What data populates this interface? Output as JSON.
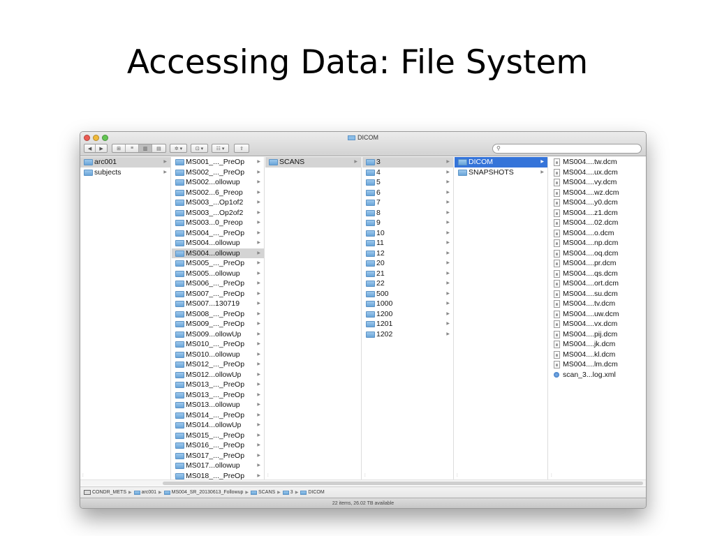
{
  "slide": {
    "title": "Accessing Data: File System"
  },
  "window": {
    "title": "DICOM"
  },
  "toolbar": {
    "back_label": "◀",
    "forward_label": "▶",
    "view_icons": "⊞",
    "view_list": "≡",
    "view_columns": "▥",
    "view_coverflow": "▤",
    "action_label": "✲ ▾",
    "arrange_label": "☷ ▾",
    "share_label": "⇪",
    "dropbox_label": "⊡ ▾",
    "search_icon": "⚲"
  },
  "columns": {
    "col1": [
      {
        "label": "arc001",
        "selected": "gray"
      },
      {
        "label": "subjects"
      }
    ],
    "col2": [
      {
        "label": "MS001_..._PreOp"
      },
      {
        "label": "MS002_..._PreOp"
      },
      {
        "label": "MS002...ollowup"
      },
      {
        "label": "MS002...6_Preop"
      },
      {
        "label": "MS003_...Op1of2"
      },
      {
        "label": "MS003_...Op2of2"
      },
      {
        "label": "MS003...0_Preop"
      },
      {
        "label": "MS004_..._PreOp"
      },
      {
        "label": "MS004...ollowup"
      },
      {
        "label": "MS004...ollowup",
        "selected": "gray"
      },
      {
        "label": "MS005_..._PreOp"
      },
      {
        "label": "MS005...ollowup"
      },
      {
        "label": "MS006_..._PreOp"
      },
      {
        "label": "MS007_..._PreOp"
      },
      {
        "label": "MS007...130719"
      },
      {
        "label": "MS008_..._PreOp"
      },
      {
        "label": "MS009_..._PreOp"
      },
      {
        "label": "MS009...ollowUp"
      },
      {
        "label": "MS010_..._PreOp"
      },
      {
        "label": "MS010...ollowup"
      },
      {
        "label": "MS012_..._PreOp"
      },
      {
        "label": "MS012...ollowUp"
      },
      {
        "label": "MS013_..._PreOp"
      },
      {
        "label": "MS013_..._PreOp"
      },
      {
        "label": "MS013...ollowup"
      },
      {
        "label": "MS014_..._PreOp"
      },
      {
        "label": "MS014...ollowUp"
      },
      {
        "label": "MS015_..._PreOp"
      },
      {
        "label": "MS016_..._PreOp"
      },
      {
        "label": "MS017_..._PreOp"
      },
      {
        "label": "MS017...ollowup"
      },
      {
        "label": "MS018_..._PreOp"
      }
    ],
    "col3": [
      {
        "label": "SCANS",
        "selected": "gray"
      }
    ],
    "col4": [
      {
        "label": "3",
        "selected": "gray"
      },
      {
        "label": "4"
      },
      {
        "label": "5"
      },
      {
        "label": "6"
      },
      {
        "label": "7"
      },
      {
        "label": "8"
      },
      {
        "label": "9"
      },
      {
        "label": "10"
      },
      {
        "label": "11"
      },
      {
        "label": "12"
      },
      {
        "label": "20"
      },
      {
        "label": "21"
      },
      {
        "label": "22"
      },
      {
        "label": "500"
      },
      {
        "label": "1000"
      },
      {
        "label": "1200"
      },
      {
        "label": "1201"
      },
      {
        "label": "1202"
      }
    ],
    "col5": [
      {
        "label": "DICOM",
        "selected": "blue"
      },
      {
        "label": "SNAPSHOTS"
      }
    ],
    "col6": [
      {
        "label": "MS004....tw.dcm",
        "kind": "dcm"
      },
      {
        "label": "MS004....ux.dcm",
        "kind": "dcm"
      },
      {
        "label": "MS004....vy.dcm",
        "kind": "dcm"
      },
      {
        "label": "MS004....wz.dcm",
        "kind": "dcm"
      },
      {
        "label": "MS004....y0.dcm",
        "kind": "dcm"
      },
      {
        "label": "MS004....z1.dcm",
        "kind": "dcm"
      },
      {
        "label": "MS004....02.dcm",
        "kind": "dcm"
      },
      {
        "label": "MS004....o.dcm",
        "kind": "dcm"
      },
      {
        "label": "MS004....np.dcm",
        "kind": "dcm"
      },
      {
        "label": "MS004....oq.dcm",
        "kind": "dcm"
      },
      {
        "label": "MS004....pr.dcm",
        "kind": "dcm"
      },
      {
        "label": "MS004....qs.dcm",
        "kind": "dcm"
      },
      {
        "label": "MS004....ort.dcm",
        "kind": "dcm"
      },
      {
        "label": "MS004....su.dcm",
        "kind": "dcm"
      },
      {
        "label": "MS004....tv.dcm",
        "kind": "dcm"
      },
      {
        "label": "MS004....uw.dcm",
        "kind": "dcm"
      },
      {
        "label": "MS004....vx.dcm",
        "kind": "dcm"
      },
      {
        "label": "MS004....pij.dcm",
        "kind": "dcm"
      },
      {
        "label": "MS004....jk.dcm",
        "kind": "dcm"
      },
      {
        "label": "MS004....kl.dcm",
        "kind": "dcm"
      },
      {
        "label": "MS004....lm.dcm",
        "kind": "dcm"
      },
      {
        "label": "scan_3...log.xml",
        "kind": "xml"
      }
    ]
  },
  "pathbar": {
    "items": [
      "CONDR_METS",
      "arc001",
      "MS004_SR_20130613_Followup",
      "SCANS",
      "3",
      "DICOM"
    ]
  },
  "status": {
    "text": "22 items, 26.02 TB available"
  },
  "colors": {
    "selection_blue": "#3574d9",
    "selection_gray": "#d4d4d4",
    "folder_blue": "#7fb3e0"
  }
}
